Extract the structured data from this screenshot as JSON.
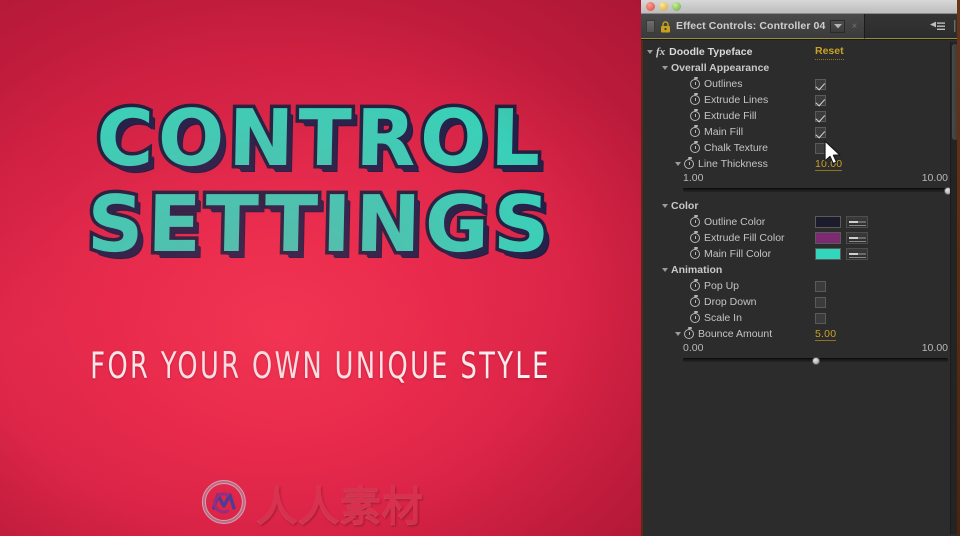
{
  "preview": {
    "headline_line1": "CONTROL",
    "headline_line2": "SETTINGS",
    "subtitle": "FOR YOUR OWN UNIQUE STYLE",
    "watermark_text": "人人素材",
    "colors": {
      "background_red": "#e8294b",
      "headline_fill": "#3ad0b8",
      "headline_outline": "#20203f",
      "subtitle": "#fdf2f2",
      "watermark": "#d8334f"
    }
  },
  "window": {
    "traffic_lights": [
      "close-button",
      "minimize-button",
      "zoom-button"
    ],
    "tab_label": "Effect Controls: Controller 04",
    "tab_lock_icon": "lock-icon",
    "tab_caret_icon": "chevron-down-icon",
    "tab_close_icon": "close-icon",
    "panel_menu_icon": "panel-menu-icon"
  },
  "effect": {
    "name": "Doodle Typeface",
    "fx_icon": "fx",
    "reset_label": "Reset"
  },
  "groups": [
    {
      "name": "Overall Appearance",
      "properties": [
        {
          "label": "Outlines",
          "type": "checkbox",
          "checked": true
        },
        {
          "label": "Extrude Lines",
          "type": "checkbox",
          "checked": true
        },
        {
          "label": "Extrude Fill",
          "type": "checkbox",
          "checked": true
        },
        {
          "label": "Main Fill",
          "type": "checkbox",
          "checked": true
        },
        {
          "label": "Chalk Texture",
          "type": "checkbox",
          "checked": false
        }
      ]
    }
  ],
  "line_thickness": {
    "label": "Line Thickness",
    "value": "10.00",
    "min": "1.00",
    "max": "10.00",
    "percent": 100
  },
  "color_group": {
    "name": "Color",
    "properties": [
      {
        "label": "Outline Color",
        "swatch": "#1d1c2c"
      },
      {
        "label": "Extrude Fill Color",
        "swatch": "#7d2a72"
      },
      {
        "label": "Main Fill Color",
        "swatch": "#32d6bd"
      }
    ]
  },
  "animation_group": {
    "name": "Animation",
    "properties": [
      {
        "label": "Pop Up",
        "type": "checkbox",
        "checked": false
      },
      {
        "label": "Drop Down",
        "type": "checkbox",
        "checked": false
      },
      {
        "label": "Scale In",
        "type": "checkbox",
        "checked": false
      }
    ]
  },
  "bounce_amount": {
    "label": "Bounce Amount",
    "value": "5.00",
    "min": "0.00",
    "max": "10.00",
    "percent": 50
  }
}
